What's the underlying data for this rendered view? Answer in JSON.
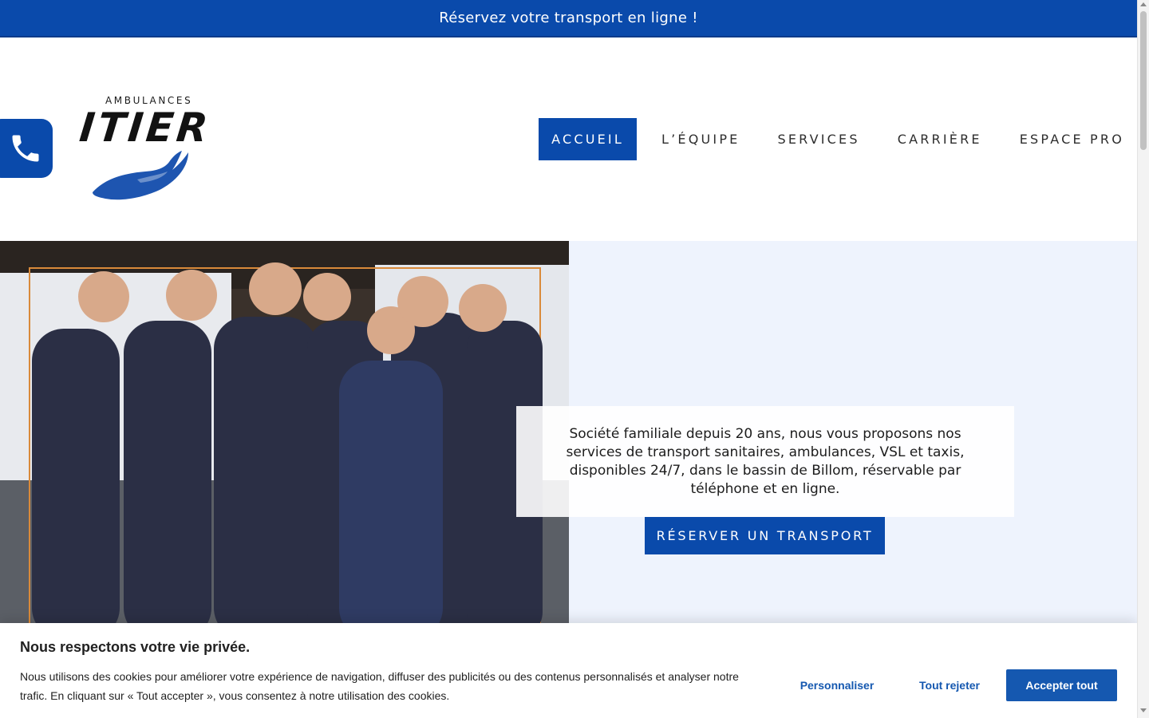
{
  "topbar": {
    "announcement": "Réservez votre transport en ligne !"
  },
  "header": {
    "phone_icon": "phone-icon",
    "logo": {
      "small_text": "AMBULANCES",
      "big_text": "ITIER",
      "hand_icon": "hand-icon"
    },
    "nav": [
      {
        "label": "ACCUEIL",
        "active": true
      },
      {
        "label": "L’ÉQUIPE",
        "active": false
      },
      {
        "label": "SERVICES",
        "active": false
      },
      {
        "label": "CARRIÈRE",
        "active": false
      },
      {
        "label": "ESPACE PRO",
        "active": false
      }
    ]
  },
  "hero": {
    "photo_subject": "team-photo",
    "description": "Société familiale depuis 20 ans, nous vous proposons nos services de transport sanitaires, ambulances, VSL et taxis, disponibles 24/7, dans le bassin de Billom, réservable par téléphone et en ligne.",
    "cta_label": "RÉSERVER UN TRANSPORT"
  },
  "cookie_banner": {
    "title": "Nous respectons votre vie privée.",
    "description": "Nous utilisons des cookies pour améliorer votre expérience de navigation, diffuser des publicités ou des contenus personnalisés et analyser notre trafic. En cliquant sur « Tout accepter », vous consentez à notre utilisation des cookies.",
    "customize_label": "Personnaliser",
    "reject_label": "Tout rejeter",
    "accept_label": "Accepter tout"
  },
  "colors": {
    "brand_blue": "#0a4aab",
    "button_blue": "#1558b0",
    "hero_background": "#eef3fd"
  }
}
